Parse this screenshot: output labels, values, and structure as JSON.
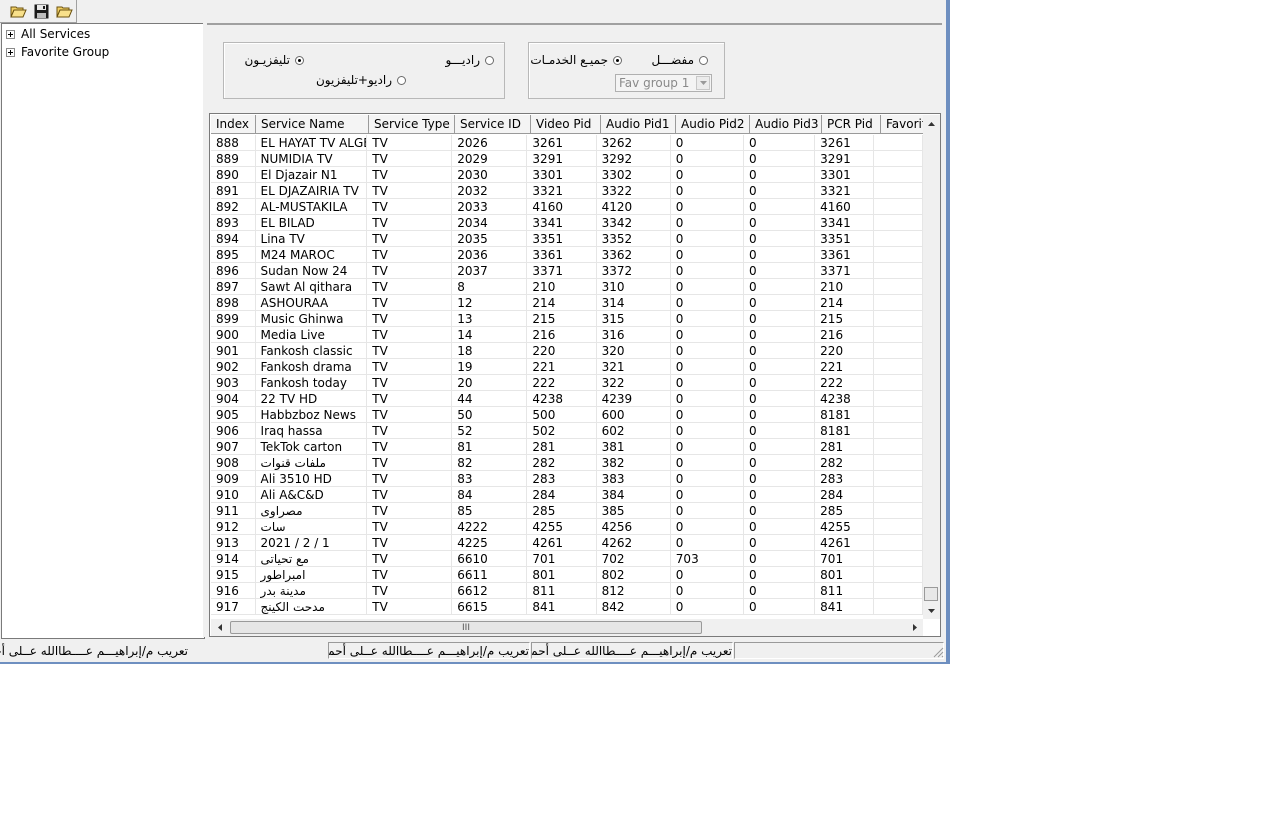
{
  "toolbar": {
    "buttons": [
      {
        "icon": "open-folder-icon"
      },
      {
        "icon": "save-disk-icon"
      },
      {
        "icon": "open-folder-icon"
      }
    ]
  },
  "tree": {
    "items": [
      {
        "label": "All Services"
      },
      {
        "label": "Favorite Group"
      }
    ]
  },
  "filters": {
    "type_group": {
      "tv_label": "تليفزيـون",
      "radio_label": "راديـــو",
      "radio_tv_label": "راديو+تليفزيون",
      "selected": "tv"
    },
    "service_group": {
      "all_label": "جميـع الخدمـات",
      "fav_label": "مفضـــل",
      "selected": "all",
      "fav_group_value": "Fav group 1"
    }
  },
  "grid": {
    "columns": [
      "Index",
      "Service Name",
      "Service Type",
      "Service ID",
      "Video Pid",
      "Audio Pid1",
      "Audio Pid2",
      "Audio Pid3",
      "PCR Pid",
      "Favorite"
    ],
    "rows": [
      [
        "888",
        "EL HAYAT TV ALGE",
        "TV",
        "2026",
        "3261",
        "3262",
        "0",
        "0",
        "3261",
        ""
      ],
      [
        "889",
        "NUMIDIA TV",
        "TV",
        "2029",
        "3291",
        "3292",
        "0",
        "0",
        "3291",
        ""
      ],
      [
        "890",
        "El Djazair N1",
        "TV",
        "2030",
        "3301",
        "3302",
        "0",
        "0",
        "3301",
        ""
      ],
      [
        "891",
        "EL DJAZAIRIA TV",
        "TV",
        "2032",
        "3321",
        "3322",
        "0",
        "0",
        "3321",
        ""
      ],
      [
        "892",
        "AL-MUSTAKILA",
        "TV",
        "2033",
        "4160",
        "4120",
        "0",
        "0",
        "4160",
        ""
      ],
      [
        "893",
        "EL BILAD",
        "TV",
        "2034",
        "3341",
        "3342",
        "0",
        "0",
        "3341",
        ""
      ],
      [
        "894",
        "Lina TV",
        "TV",
        "2035",
        "3351",
        "3352",
        "0",
        "0",
        "3351",
        ""
      ],
      [
        "895",
        "M24 MAROC",
        "TV",
        "2036",
        "3361",
        "3362",
        "0",
        "0",
        "3361",
        ""
      ],
      [
        "896",
        "Sudan Now 24",
        "TV",
        "2037",
        "3371",
        "3372",
        "0",
        "0",
        "3371",
        ""
      ],
      [
        "897",
        "Sawt Al qithara",
        "TV",
        "8",
        "210",
        "310",
        "0",
        "0",
        "210",
        ""
      ],
      [
        "898",
        "ASHOURAA",
        "TV",
        "12",
        "214",
        "314",
        "0",
        "0",
        "214",
        ""
      ],
      [
        "899",
        "Music Ghinwa",
        "TV",
        "13",
        "215",
        "315",
        "0",
        "0",
        "215",
        ""
      ],
      [
        "900",
        "Media Live",
        "TV",
        "14",
        "216",
        "316",
        "0",
        "0",
        "216",
        ""
      ],
      [
        "901",
        "Fankosh classic",
        "TV",
        "18",
        "220",
        "320",
        "0",
        "0",
        "220",
        ""
      ],
      [
        "902",
        "Fankosh drama",
        "TV",
        "19",
        "221",
        "321",
        "0",
        "0",
        "221",
        ""
      ],
      [
        "903",
        "Fankosh today",
        "TV",
        "20",
        "222",
        "322",
        "0",
        "0",
        "222",
        ""
      ],
      [
        "904",
        "22 TV HD",
        "TV",
        "44",
        "4238",
        "4239",
        "0",
        "0",
        "4238",
        ""
      ],
      [
        "905",
        "Habbzboz News",
        "TV",
        "50",
        "500",
        "600",
        "0",
        "0",
        "8181",
        ""
      ],
      [
        "906",
        "Iraq hassa",
        "TV",
        "52",
        "502",
        "602",
        "0",
        "0",
        "8181",
        ""
      ],
      [
        "907",
        "TekTok carton",
        "TV",
        "81",
        "281",
        "381",
        "0",
        "0",
        "281",
        ""
      ],
      [
        "908",
        "ملفات قنوات",
        "TV",
        "82",
        "282",
        "382",
        "0",
        "0",
        "282",
        ""
      ],
      [
        "909",
        "Ali 3510 HD",
        "TV",
        "83",
        "283",
        "383",
        "0",
        "0",
        "283",
        ""
      ],
      [
        "910",
        "Ali A&C&D",
        "TV",
        "84",
        "284",
        "384",
        "0",
        "0",
        "284",
        ""
      ],
      [
        "911",
        "مصراوى",
        "TV",
        "85",
        "285",
        "385",
        "0",
        "0",
        "285",
        ""
      ],
      [
        "912",
        "سات",
        "TV",
        "4222",
        "4255",
        "4256",
        "0",
        "0",
        "4255",
        ""
      ],
      [
        "913",
        "2021 / 2 / 1",
        "TV",
        "4225",
        "4261",
        "4262",
        "0",
        "0",
        "4261",
        ""
      ],
      [
        "914",
        "مع تحياتى",
        "TV",
        "6610",
        "701",
        "702",
        "703",
        "0",
        "701",
        ""
      ],
      [
        "915",
        "امبراطور",
        "TV",
        "6611",
        "801",
        "802",
        "0",
        "0",
        "801",
        ""
      ],
      [
        "916",
        "مدينة بدر",
        "TV",
        "6612",
        "811",
        "812",
        "0",
        "0",
        "811",
        ""
      ],
      [
        "917",
        "مدحت الكينج",
        "TV",
        "6615",
        "841",
        "842",
        "0",
        "0",
        "841",
        ""
      ]
    ],
    "hscroll_grip": "III"
  },
  "statusbar": {
    "panels": [
      "تعريب م/إبراهيـــم عــــطاالله عــلى أحمـد",
      "تعريب م/إبراهيـــم عــــطاالله عــلى أحمـد",
      "تعريب م/إبراهيـــم عــــطاالله عــلى أحمـد",
      ""
    ]
  }
}
